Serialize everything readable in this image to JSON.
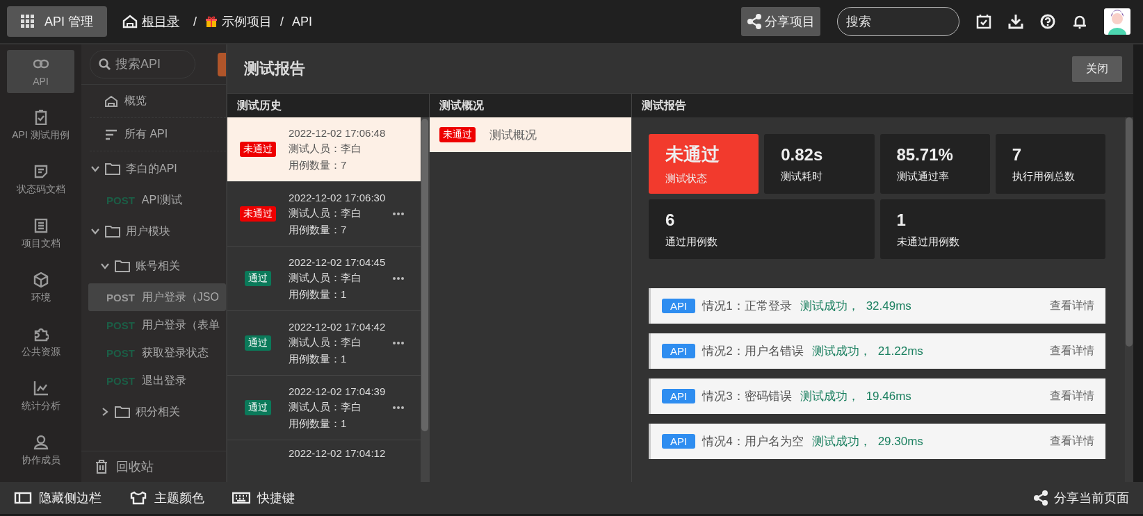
{
  "topbar": {
    "app_button": "API 管理",
    "breadcrumb": [
      {
        "kind": "home",
        "label": "根目录"
      },
      {
        "kind": "sep",
        "label": "/"
      },
      {
        "kind": "project",
        "label": "示例项目"
      },
      {
        "kind": "sep",
        "label": "/"
      },
      {
        "kind": "plain",
        "label": "API"
      }
    ],
    "share_button": "分享项目",
    "search": {
      "placeholder": "搜索"
    }
  },
  "nav": [
    {
      "label": "API",
      "selected": true
    },
    {
      "label": "API 测试用例",
      "selected": false
    },
    {
      "label": "状态码文档",
      "selected": false
    },
    {
      "label": "项目文档",
      "selected": false
    },
    {
      "label": "环境",
      "selected": false
    },
    {
      "label": "公共资源",
      "selected": false
    },
    {
      "label": "统计分析",
      "selected": false
    },
    {
      "label": "协作成员",
      "selected": false
    }
  ],
  "tree": {
    "search": {
      "placeholder": "搜索API"
    },
    "items": [
      {
        "kind": "overview",
        "label": "概览"
      },
      {
        "kind": "all",
        "label": "所有 API"
      },
      {
        "kind": "folder",
        "label": "李白的API",
        "expanded": true,
        "children": [
          {
            "kind": "api",
            "method": "POST",
            "label": "API测试",
            "selected": false
          }
        ]
      },
      {
        "kind": "folder",
        "label": "用户模块",
        "expanded": true,
        "children": [
          {
            "kind": "folder",
            "label": "账号相关",
            "expanded": true,
            "children": [
              {
                "kind": "api",
                "method": "POST",
                "label": "用户登录（JSO",
                "selected": true
              },
              {
                "kind": "api",
                "method": "POST",
                "label": "用户登录（表单",
                "selected": false
              },
              {
                "kind": "api",
                "method": "POST",
                "label": "获取登录状态",
                "selected": false
              },
              {
                "kind": "api",
                "method": "POST",
                "label": "退出登录",
                "selected": false
              }
            ]
          },
          {
            "kind": "folder",
            "label": "积分相关",
            "expanded": false
          }
        ]
      }
    ],
    "trash": "回收站"
  },
  "report": {
    "title": "测试报告",
    "close_button": "关闭",
    "history": {
      "heading": "测试历史",
      "items": [
        {
          "kind": "fail",
          "status_label": "未通过",
          "time": "2022-12-02 17:06:48",
          "tester": "测试人员：李白",
          "count": "用例数量：7",
          "selected": true
        },
        {
          "kind": "fail",
          "status_label": "未通过",
          "time": "2022-12-02 17:06:30",
          "tester": "测试人员：李白",
          "count": "用例数量：7",
          "selected": false
        },
        {
          "kind": "pass",
          "status_label": "通过",
          "time": "2022-12-02 17:04:45",
          "tester": "测试人员：李白",
          "count": "用例数量：1",
          "selected": false
        },
        {
          "kind": "pass",
          "status_label": "通过",
          "time": "2022-12-02 17:04:42",
          "tester": "测试人员：李白",
          "count": "用例数量：1",
          "selected": false
        },
        {
          "kind": "pass",
          "status_label": "通过",
          "time": "2022-12-02 17:04:39",
          "tester": "测试人员：李白",
          "count": "用例数量：1",
          "selected": false
        },
        {
          "time": "2022-12-02 17:04:12",
          "selected": false
        }
      ]
    },
    "overview": {
      "heading": "测试概况",
      "items": [
        {
          "kind": "fail",
          "status_label": "未通过",
          "label": "测试概况",
          "selected": true
        }
      ]
    },
    "detail": {
      "heading": "测试报告",
      "stats": [
        {
          "kind": "status",
          "value": "未通过",
          "label": "测试状态"
        },
        {
          "kind": "plain",
          "value": "0.82s",
          "label": "测试耗时"
        },
        {
          "kind": "plain",
          "value": "85.71%",
          "label": "测试通过率"
        },
        {
          "kind": "plain",
          "value": "7",
          "label": "执行用例总数"
        },
        {
          "kind": "wide",
          "value": "6",
          "label": "通过用例数"
        },
        {
          "kind": "wide",
          "value": "1",
          "label": "未通过用例数"
        }
      ],
      "cases": [
        {
          "tag": "API",
          "title": "情况1：正常登录",
          "result": "测试成功，",
          "duration": "32.49ms",
          "link": "查看详情"
        },
        {
          "tag": "API",
          "title": "情况2：用户名错误",
          "result": "测试成功，",
          "duration": "21.22ms",
          "link": "查看详情"
        },
        {
          "tag": "API",
          "title": "情况3：密码错误",
          "result": "测试成功，",
          "duration": "19.46ms",
          "link": "查看详情"
        },
        {
          "tag": "API",
          "title": "情况4：用户名为空",
          "result": "测试成功，",
          "duration": "29.30ms",
          "link": "查看详情"
        }
      ]
    }
  },
  "bottombar": {
    "items": [
      {
        "label": "隐藏侧边栏"
      },
      {
        "label": "主题颜色"
      },
      {
        "label": "快捷键"
      }
    ],
    "share": "分享当前页面"
  }
}
